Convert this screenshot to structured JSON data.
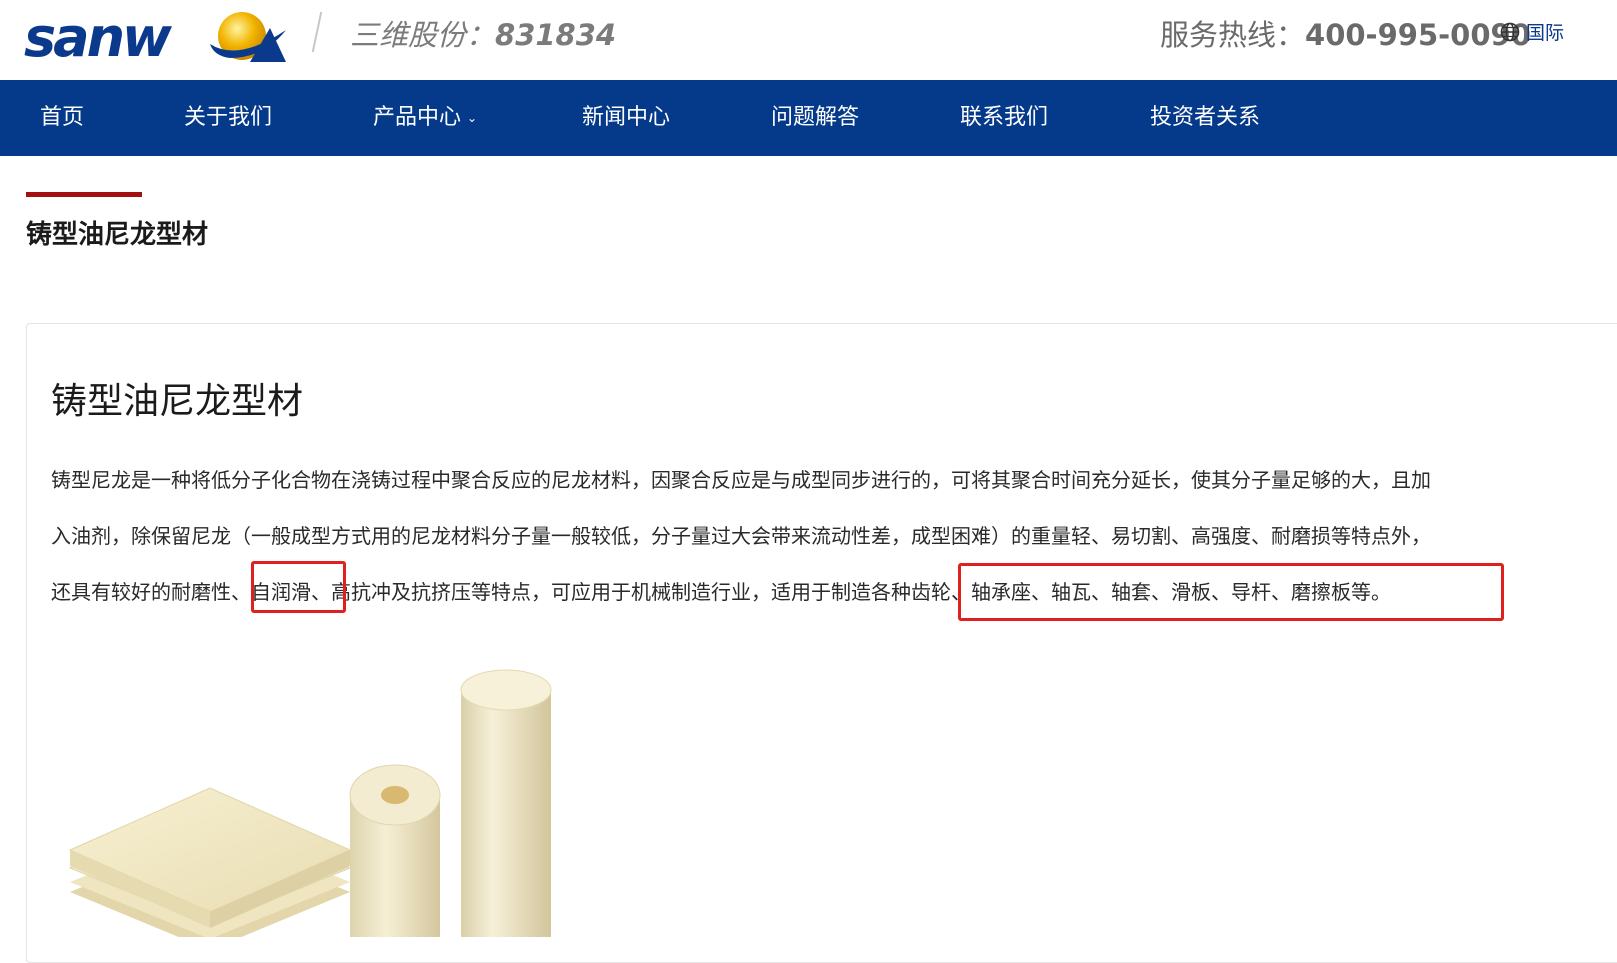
{
  "header": {
    "logo_text": "sanwei",
    "stock_label": "三维股份：",
    "stock_code": "831834",
    "hotline_label": "服务热线：",
    "hotline_number": "400-995-0090",
    "language_label": "国际"
  },
  "nav": {
    "items": [
      {
        "label": "首页"
      },
      {
        "label": "关于我们"
      },
      {
        "label": "产品中心",
        "has_dropdown": true
      },
      {
        "label": "新闻中心"
      },
      {
        "label": "问题解答"
      },
      {
        "label": "联系我们"
      },
      {
        "label": "投资者关系"
      }
    ]
  },
  "page": {
    "title": "铸型油尼龙型材"
  },
  "article": {
    "title": "铸型油尼龙型材",
    "lines": [
      "铸型尼龙是一种将低分子化合物在浇铸过程中聚合反应的尼龙材料，因聚合反应是与成型同步进行的，可将其聚合时间充分延长，使其分子量足够的大，且加",
      "入油剂，除保留尼龙（一般成型方式用的尼龙材料分子量一般较低，分子量过大会带来流动性差，成型困难）的重量轻、易切割、高强度、耐磨损等特点外，",
      "还具有较好的耐磨性、自润滑、高抗冲及抗挤压等特点，可应用于机械制造行业，适用于制造各种齿轮、轴承座、轴瓦、轴套、滑板、导杆、磨擦板等。"
    ]
  },
  "colors": {
    "nav_bg": "#053a8b",
    "accent_red": "#a31010",
    "highlight_box": "#e0201d",
    "logo_blue": "#0b3a8c",
    "logo_gold": "#f2b400"
  }
}
